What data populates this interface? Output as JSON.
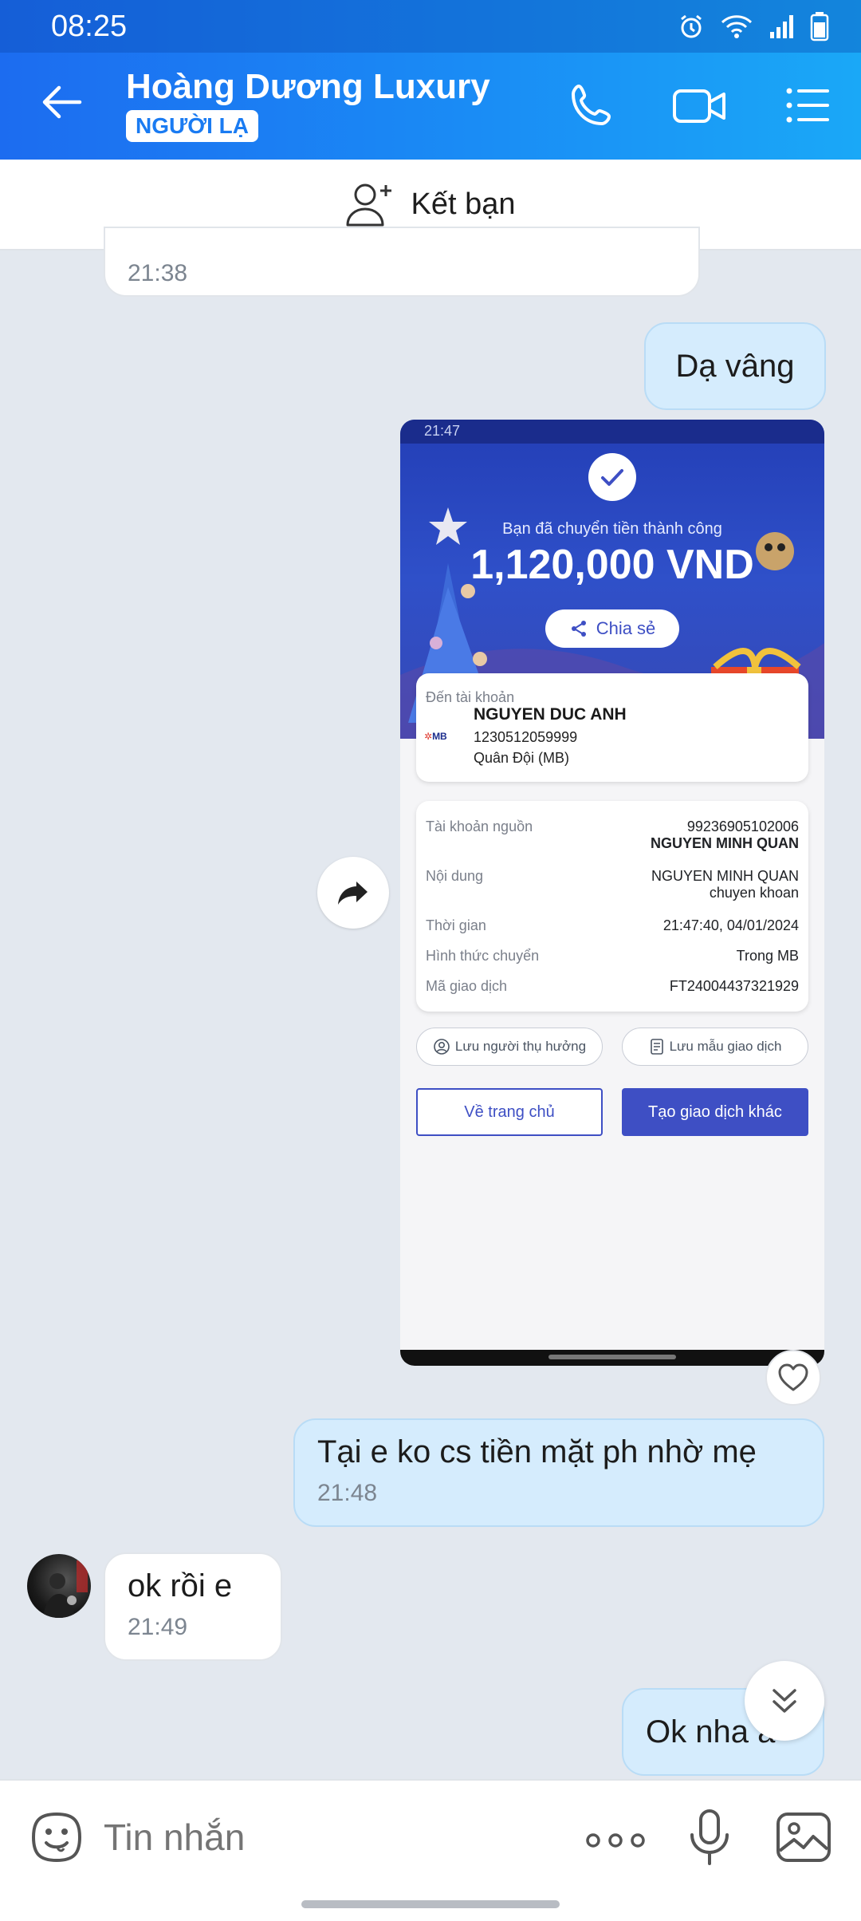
{
  "status_bar": {
    "time": "08:25"
  },
  "header": {
    "chat_name": "Hoàng Dương Luxury",
    "badge": "NGƯỜI LẠ"
  },
  "friend_bar": {
    "label": "Kết bạn"
  },
  "messages": [
    {
      "dir": "in",
      "text": "",
      "time": "21:38"
    },
    {
      "dir": "out",
      "text": "Dạ vâng"
    },
    {
      "dir": "out",
      "text": "Tại e ko cs tiền mặt ph nhờ mẹ",
      "time": "21:48"
    },
    {
      "dir": "in",
      "text": "ok rồi e",
      "time": "21:49"
    },
    {
      "dir": "out",
      "text": "Ok nha a"
    }
  ],
  "receipt": {
    "status_time": "21:47",
    "title": "Bạn đã chuyển tiền thành công",
    "amount": "1,120,000 VND",
    "share_label": "Chia sẻ",
    "to_account_label": "Đến tài khoản",
    "bank_logo": "MB",
    "recipient_name": "NGUYEN DUC ANH",
    "recipient_account": "1230512059999",
    "recipient_bank": "Quân Đội (MB)",
    "rows": [
      {
        "label": "Tài khoản nguồn",
        "value": "99236905102006",
        "value2": "NGUYEN MINH QUAN"
      },
      {
        "label": "Nội dung",
        "value": "NGUYEN MINH QUAN",
        "value2": "chuyen khoan"
      },
      {
        "label": "Thời gian",
        "value": "21:47:40, 04/01/2024"
      },
      {
        "label": "Hình thức chuyển",
        "value": "Trong MB"
      },
      {
        "label": "Mã giao dịch",
        "value": "FT24004437321929"
      }
    ],
    "save_beneficiary": "Lưu người thụ hưởng",
    "save_template": "Lưu mẫu giao dịch",
    "home_btn": "Về trang chủ",
    "new_tx_btn": "Tạo giao dịch khác"
  },
  "input": {
    "placeholder": "Tin nhắn"
  },
  "colors": {
    "header": "#1a8cf5",
    "out_bubble": "#d5ecfd",
    "receipt_primary": "#3e4fc4"
  }
}
